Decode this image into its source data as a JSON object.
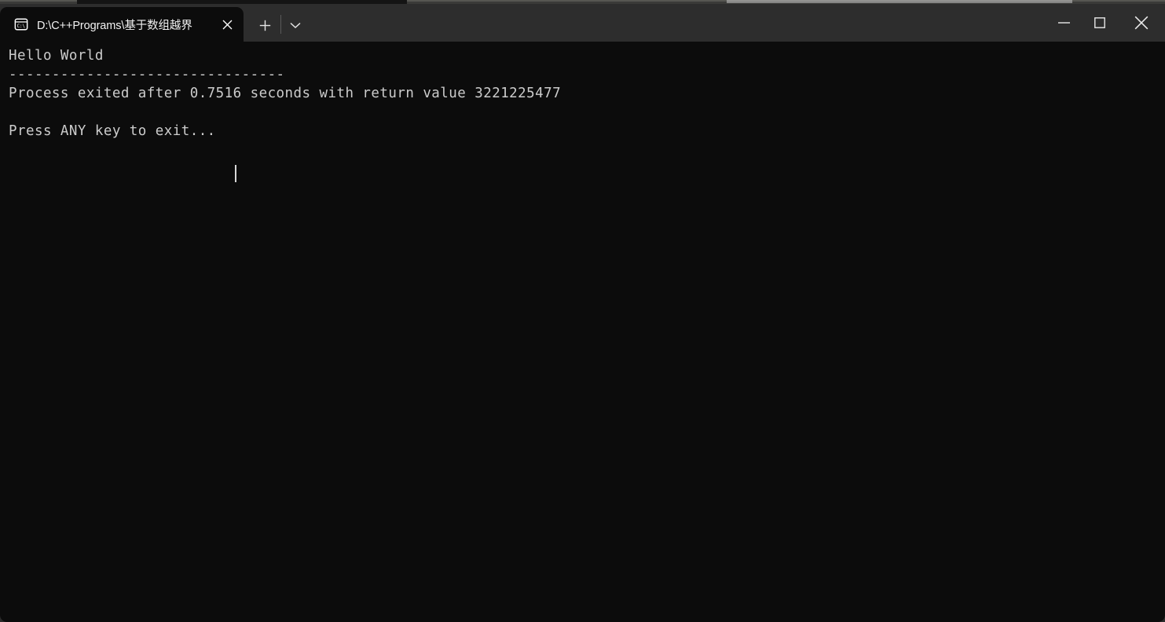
{
  "window": {
    "title_bar": {
      "tab": {
        "icon": "cmd-prompt-icon",
        "title": "D:\\C++Programs\\基于数组越界",
        "close_icon": "close-icon"
      },
      "new_tab_icon": "plus-icon",
      "dropdown_icon": "chevron-down-icon",
      "controls": {
        "minimize_icon": "minimize-icon",
        "maximize_icon": "maximize-icon",
        "close_icon": "close-icon"
      }
    },
    "terminal": {
      "lines": [
        "Hello World",
        "--------------------------------",
        "Process exited after 0.7516 seconds with return value 3221225477",
        "",
        "Press ANY key to exit..."
      ],
      "text": "Hello World\n--------------------------------\nProcess exited after 0.7516 seconds with return value 3221225477\n\nPress ANY key to exit...",
      "cursor": "text-cursor"
    }
  },
  "colors": {
    "titlebar_bg": "#2d2d2d",
    "terminal_bg": "#0c0c0c",
    "terminal_fg": "#cccccc",
    "tab_active_bg": "#0c0c0c"
  }
}
